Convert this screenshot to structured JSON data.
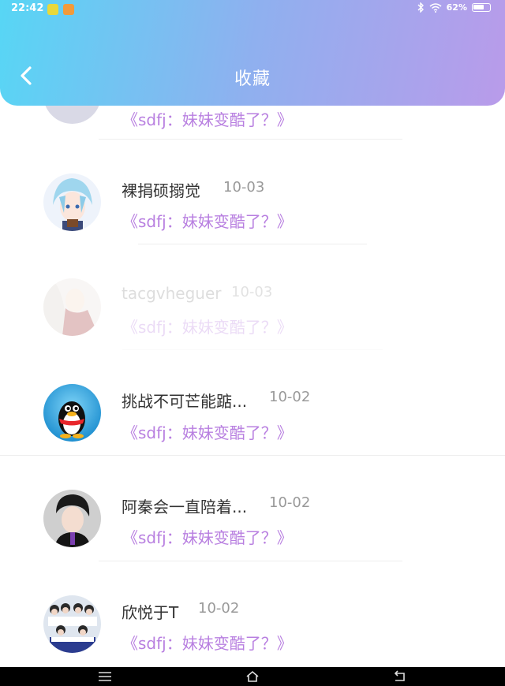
{
  "status_bar": {
    "time": "22:42",
    "battery": "62%",
    "icons": [
      "wechat-icon",
      "weibo-icon",
      "bluetooth-icon",
      "wifi-icon",
      "battery-icon"
    ]
  },
  "header": {
    "title": "收藏",
    "back_icon": "chevron-left-icon",
    "colors": {
      "gradient_start": "#57d6f5",
      "gradient_end": "#b99bea"
    }
  },
  "items": [
    {
      "name": "",
      "date": "",
      "subtitle": "《sdfj：妹妹变酷了？》",
      "state": "scrolled-partial"
    },
    {
      "name": "裸捐硕搦觉",
      "date": "10-03",
      "subtitle": "《sdfj：妹妹变酷了？》",
      "state": "normal"
    },
    {
      "name": "tacgvheguer",
      "date": "10-03",
      "subtitle": "《sdfj：妹妹变酷了？》",
      "state": "faded"
    },
    {
      "name": "挑战不可芒能踮...",
      "date": "10-02",
      "subtitle": "《sdfj：妹妹变酷了？》",
      "state": "normal"
    },
    {
      "name": "阿秦会一直陪着...",
      "date": "10-02",
      "subtitle": "《sdfj：妹妹变酷了？》",
      "state": "normal"
    },
    {
      "name": "欣悦于T",
      "date": "10-02",
      "subtitle": "《sdfj：妹妹变酷了？》",
      "state": "normal"
    }
  ],
  "accent_color": "#b87fe0",
  "nav_bar": {
    "icons": [
      "menu-icon",
      "home-icon",
      "back-icon"
    ]
  }
}
